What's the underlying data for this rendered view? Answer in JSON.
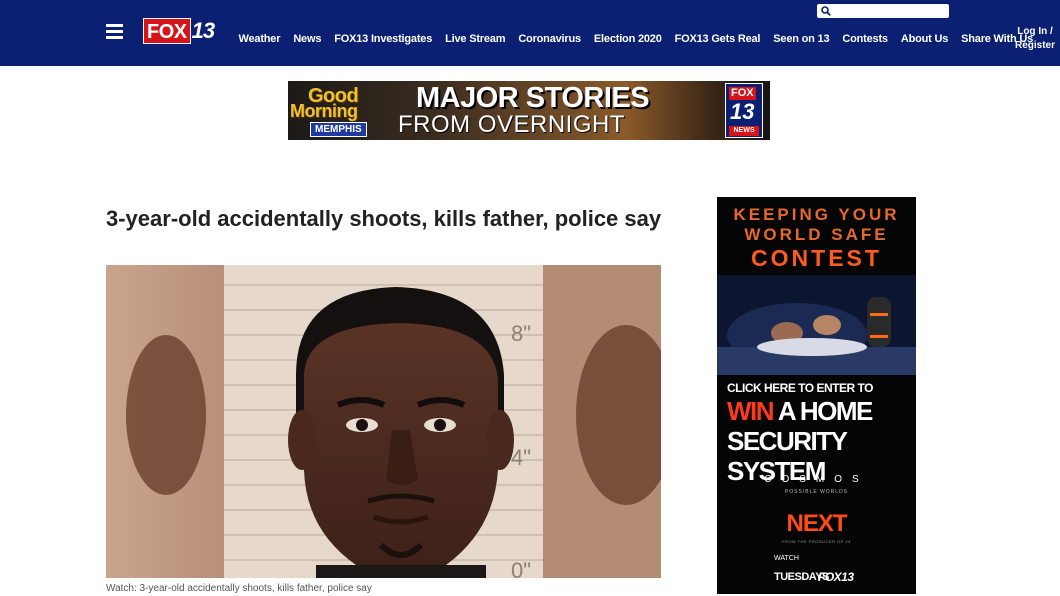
{
  "header": {
    "logo_fox": "FOX",
    "logo_number": "13",
    "nav": [
      {
        "label": "Weather"
      },
      {
        "label": "News"
      },
      {
        "label": "FOX13 Investigates"
      },
      {
        "label": "Live Stream"
      },
      {
        "label": "Coronavirus"
      },
      {
        "label": "Election 2020"
      },
      {
        "label": "FOX13 Gets Real"
      },
      {
        "label": "Seen on 13"
      },
      {
        "label": "Contests"
      },
      {
        "label": "About Us"
      },
      {
        "label": "Share With Us"
      }
    ],
    "search_value": "",
    "login_line1": "Log In /",
    "login_line2": "Register"
  },
  "banner_ad": {
    "good": "Good",
    "morning": "Morning",
    "memphis": "MEMPHIS",
    "major": "MAJOR STORIES",
    "overnight": "FROM OVERNIGHT",
    "badge_fox": "FOX",
    "badge_13": "13",
    "badge_news": "NEWS"
  },
  "article": {
    "headline": "3-year-old accidentally shoots, kills father, police say",
    "caption": "Watch: 3-year-old accidentally shoots, kills father, police say",
    "photo_marks": {
      "mark_8": "8\"",
      "mark_4": "4\"",
      "mark_0": "0\""
    }
  },
  "side_ad": {
    "line1": "KEEPING YOUR",
    "line2": "WORLD SAFE",
    "line3": "CONTEST",
    "click": "CLICK HERE TO ENTER TO",
    "win": "WIN",
    "a_home": "A HOME",
    "security": "SECURITY SYSTEM",
    "cosmos": "COSMOS",
    "possible": "POSSIBLE WORLDS",
    "next": "NEXT",
    "producer": "FROM THE PRODUCER OF 24",
    "watch": "WATCH",
    "tuesdays": "TUESDAYS",
    "fox13": "FOX13"
  },
  "colors": {
    "header_bg": "#0b1f73",
    "fox_red": "#d7141a",
    "headline": "#222222",
    "ad_orange": "#e8672a"
  }
}
